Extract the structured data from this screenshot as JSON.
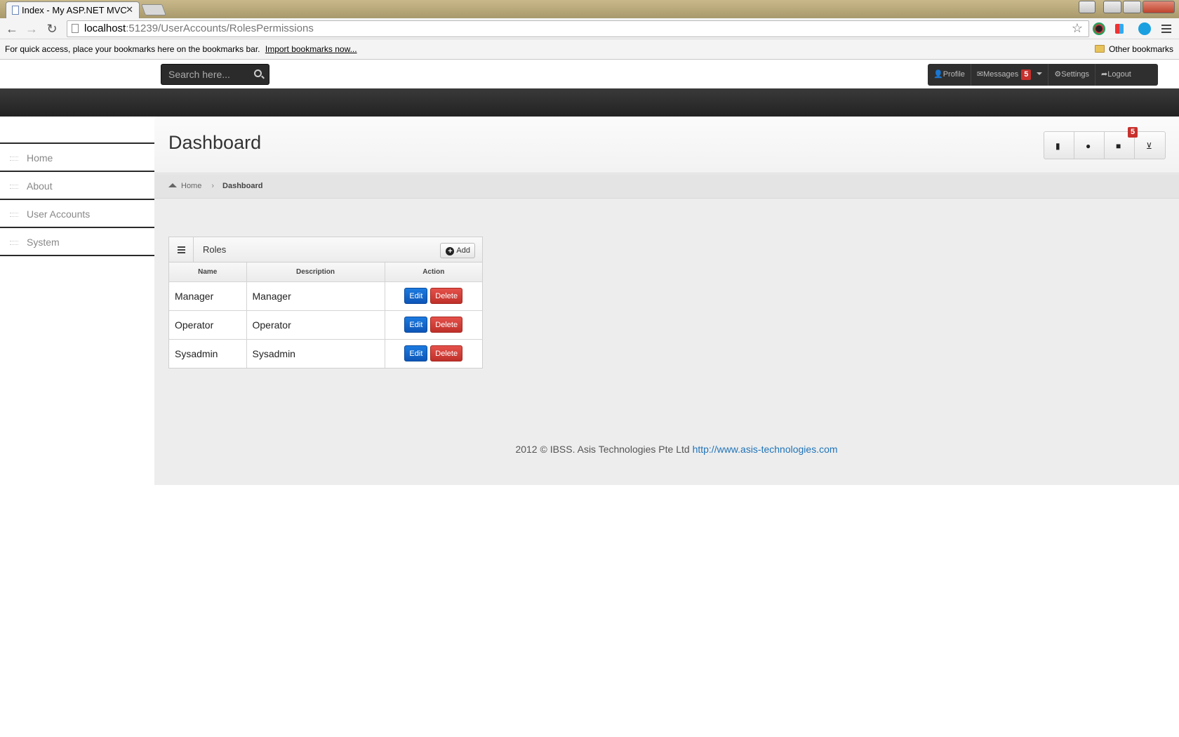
{
  "browser": {
    "active_tab_title": "Index - My ASP.NET MVC",
    "url_host": "localhost",
    "url_path": ":51239/UserAccounts/RolesPermissions",
    "bookmarks_bar_text": "For quick access, place your bookmarks here on the bookmarks bar.",
    "import_bookmarks_link": "Import bookmarks now...",
    "other_bookmarks": "Other bookmarks",
    "close_tab_glyph": "✕"
  },
  "topbar": {
    "search_placeholder": "Search here...",
    "profile": "Profile",
    "messages": "Messages",
    "messages_count": "5",
    "settings": "Settings",
    "logout": "Logout"
  },
  "sidebar": {
    "items": [
      {
        "label": "Home"
      },
      {
        "label": "About"
      },
      {
        "label": "User Accounts"
      },
      {
        "label": "System"
      }
    ]
  },
  "header": {
    "title": "Dashboard",
    "quick_buttons": [
      "document-icon",
      "user-icon",
      "comment-icon",
      "cart-icon"
    ],
    "comments_badge": "5"
  },
  "breadcrumb": {
    "home": "Home",
    "current": "Dashboard"
  },
  "roles_widget": {
    "title": "Roles",
    "add_label": "Add",
    "columns": [
      "Name",
      "Description",
      "Action"
    ],
    "rows": [
      {
        "name": "Manager",
        "description": "Manager",
        "edit": "Edit",
        "delete": "Delete"
      },
      {
        "name": "Operator",
        "description": "Operator",
        "edit": "Edit",
        "delete": "Delete"
      },
      {
        "name": "Sysadmin",
        "description": "Sysadmin",
        "edit": "Edit",
        "delete": "Delete"
      }
    ]
  },
  "footer": {
    "text": "2012 © IBSS. Asis Technologies Pte Ltd",
    "link": "http://www.asis-technologies.com"
  },
  "colors": {
    "accent_blue": "#0e56b8",
    "danger_red": "#c0302a",
    "badge_red": "#c8312d",
    "dark_bar": "#2f2f2f"
  }
}
